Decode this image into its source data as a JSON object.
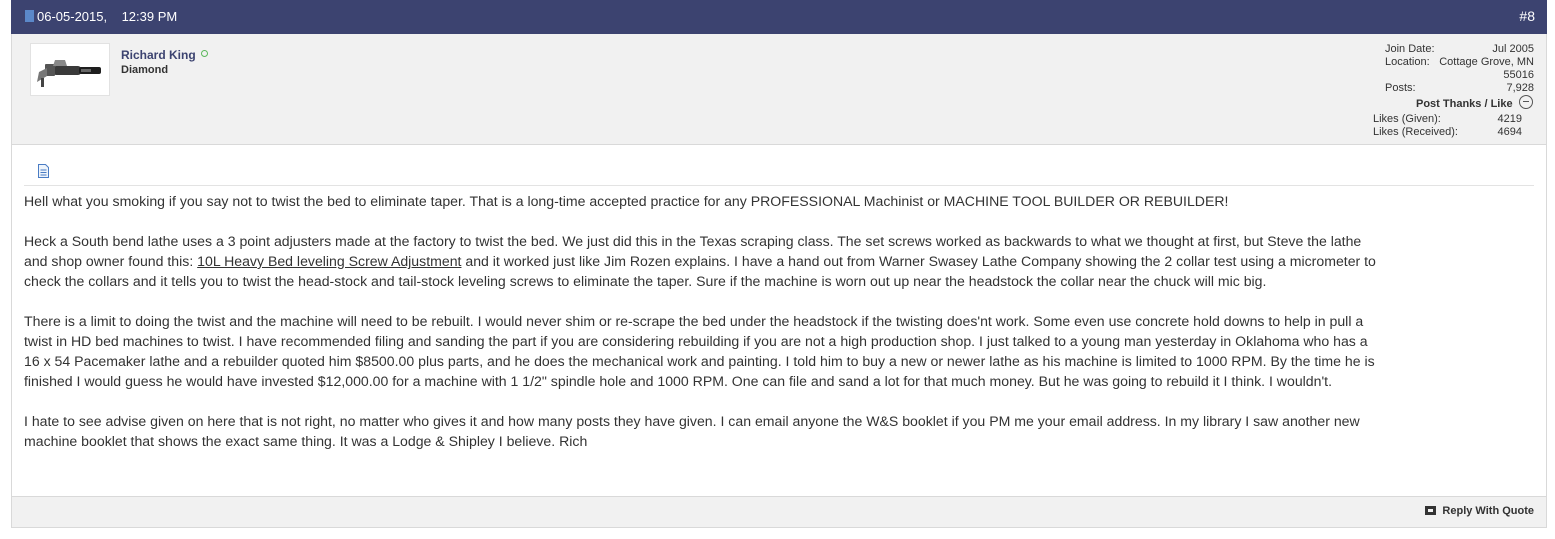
{
  "post": {
    "date": "06-05-2015,",
    "time": "12:39 PM",
    "number": "#8"
  },
  "user": {
    "name": "Richard King",
    "title": "Diamond",
    "join_date_label": "Join Date:",
    "join_date": "Jul 2005",
    "location_label": "Location:",
    "location_line1": "Cottage Grove, MN",
    "location_line2": "55016",
    "posts_label": "Posts:",
    "posts": "7,928",
    "thanks_title": "Post Thanks / Like",
    "likes_given_label": "Likes (Given):",
    "likes_given": "4219",
    "likes_received_label": "Likes (Received):",
    "likes_received": "4694"
  },
  "content": {
    "p1": "Hell what you smoking if you say not to twist the bed to eliminate taper. That is a long-time accepted practice for any PROFESSIONAL Machinist or MACHINE TOOL BUILDER OR REBUILDER!",
    "p2_line1": "Heck a South bend lathe uses a 3 point adjusters made at the factory to twist the bed. We just did this in the Texas scraping class. The set screws worked as backwards to what we thought at first, but Steve the lathe",
    "p2_line2_pre": "and shop owner found this: ",
    "p2_link": "10L Heavy Bed leveling Screw Adjustment",
    "p2_line2_post": " and it worked just like Jim Rozen explains. I have a hand out from Warner Swasey Lathe Company showing the 2 collar test using a micrometer to",
    "p2_line3": "check the collars and it tells you to twist the head-stock and tail-stock leveling screws to eliminate the taper. Sure if the machine is worn out up near the headstock the collar near the chuck will mic big.",
    "p3_line1": "There is a limit to doing the twist and the machine will need to be rebuilt. I would never shim or re-scrape the bed under the headstock if the twisting does'nt work. Some even use concrete hold downs to help in pull a",
    "p3_line2": "twist in HD bed machines to twist. I have recommended filing and sanding the part if you are considering rebuilding if you are not a high production shop. I just talked to a young man yesterday in Oklahoma who has a",
    "p3_line3": "16 x 54 Pacemaker lathe and a rebuilder quoted him $8500.00 plus parts, and he does the mechanical work and painting. I told him to buy a new or newer lathe as his machine is limited to 1000 RPM. By the time he is",
    "p3_line4": "finished I would guess he would have invested $12,000.00 for a machine with 1 1/2\" spindle hole and 1000 RPM. One can file and sand a lot for that much money. But he was going to rebuild it I think. I wouldn't.",
    "p4_line1": "I hate to see advise given on here that is not right, no matter who gives it and how many posts they have given. I can email anyone the W&S booklet if you PM me your email address. In my library I saw another new",
    "p4_line2": "machine booklet that shows the exact same thing. It was a Lodge & Shipley I believe. Rich"
  },
  "footer": {
    "reply_label": "Reply With Quote"
  }
}
